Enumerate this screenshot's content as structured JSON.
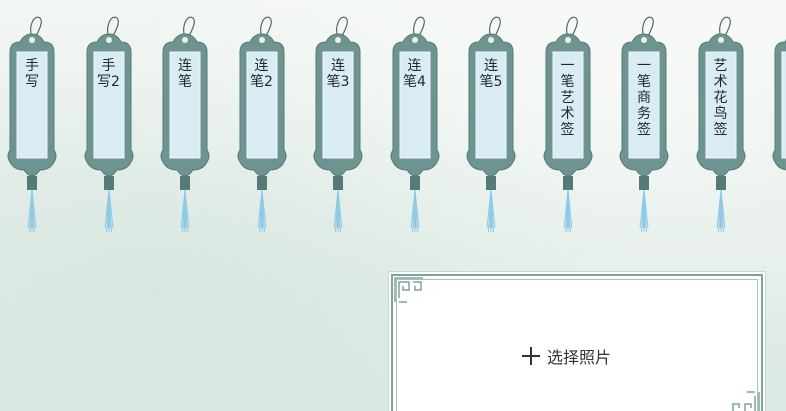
{
  "styles": {
    "tags": [
      {
        "label": "手写"
      },
      {
        "label": "手写2"
      },
      {
        "label": "连笔"
      },
      {
        "label": "连笔2"
      },
      {
        "label": "连笔3"
      },
      {
        "label": "连笔4"
      },
      {
        "label": "连笔5"
      },
      {
        "label": "一笔艺术签"
      },
      {
        "label": "一笔商务签"
      },
      {
        "label": "艺术花鸟签"
      },
      {
        "label": ""
      }
    ]
  },
  "photo_picker": {
    "select_label": "选择照片"
  },
  "colors": {
    "tag_frame": "#6e9491",
    "tag_frame_dark": "#557b78",
    "tag_panel": "#d9ecf3",
    "tassel": "#8ec9e6",
    "tassel_cap": "#557b78",
    "card_border": "#7fa29d"
  },
  "icons": {
    "tag_string": "hanging-string-icon",
    "tassel": "tassel-icon",
    "plus": "plus-icon",
    "corner": "fret-corner-icon"
  }
}
